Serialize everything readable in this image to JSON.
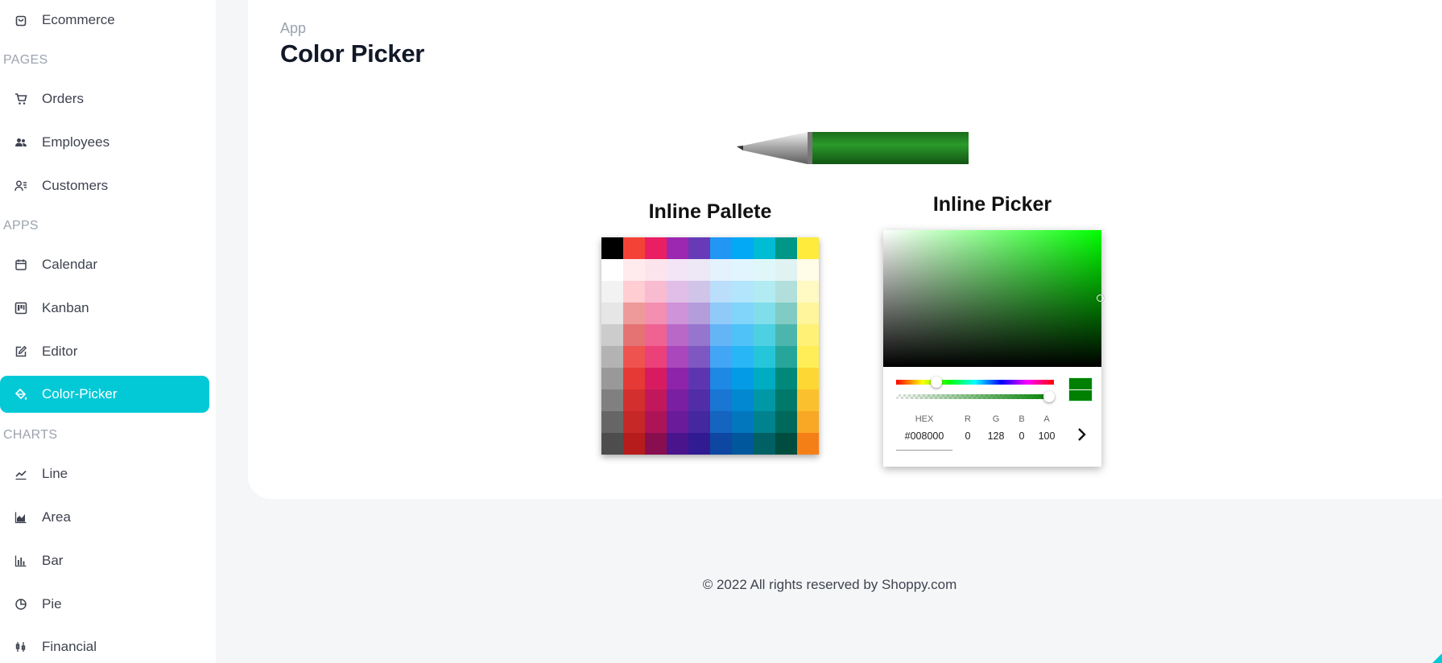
{
  "sidebar": {
    "items": [
      {
        "label": "Ecommerce",
        "icon": "shopping-bag-icon"
      },
      {
        "label": "Orders",
        "icon": "cart-icon"
      },
      {
        "label": "Employees",
        "icon": "employees-icon"
      },
      {
        "label": "Customers",
        "icon": "customers-icon"
      },
      {
        "label": "Calendar",
        "icon": "calendar-icon"
      },
      {
        "label": "Kanban",
        "icon": "kanban-icon"
      },
      {
        "label": "Editor",
        "icon": "edit-icon"
      },
      {
        "label": "Color-Picker",
        "icon": "color-fill-icon"
      },
      {
        "label": "Line",
        "icon": "line-chart-icon"
      },
      {
        "label": "Area",
        "icon": "area-chart-icon"
      },
      {
        "label": "Bar",
        "icon": "bar-chart-icon"
      },
      {
        "label": "Pie",
        "icon": "pie-chart-icon"
      },
      {
        "label": "Financial",
        "icon": "financial-icon"
      }
    ],
    "sections": [
      "PAGES",
      "APPS",
      "CHARTS"
    ],
    "active": "Color-Picker"
  },
  "header": {
    "breadcrumb": "App",
    "title": "Color Picker"
  },
  "pen_color": "#1c7d1c",
  "palette": {
    "title": "Inline Pallete",
    "colors": [
      [
        "#000000",
        "#f44336",
        "#e91e63",
        "#9c27b0",
        "#673ab7",
        "#2196f3",
        "#03a9f4",
        "#00bcd4",
        "#009688",
        "#ffeb3b"
      ],
      [
        "#ffffff",
        "#ffebee",
        "#fce4ec",
        "#f3e5f5",
        "#ede7f6",
        "#e3f2fd",
        "#e1f5fe",
        "#e0f7fa",
        "#e0f2f1",
        "#fffde7"
      ],
      [
        "#f2f2f2",
        "#ffcdd2",
        "#f8bbd0",
        "#e1bee7",
        "#d1c4e9",
        "#bbdefb",
        "#b3e5fc",
        "#b2ebf2",
        "#b2dfdb",
        "#fff9c4"
      ],
      [
        "#e6e6e6",
        "#ef9a9a",
        "#f48fb1",
        "#ce93d8",
        "#b39ddb",
        "#90caf9",
        "#81d4fa",
        "#80deea",
        "#80cbc4",
        "#fff59d"
      ],
      [
        "#cccccc",
        "#e57373",
        "#f06292",
        "#ba68c8",
        "#9575cd",
        "#64b5f6",
        "#4fc3f7",
        "#4dd0e1",
        "#4db6ac",
        "#fff176"
      ],
      [
        "#b3b3b3",
        "#ef5350",
        "#ec407a",
        "#ab47bc",
        "#7e57c2",
        "#42a5f5",
        "#29b6f6",
        "#26c6da",
        "#26a69a",
        "#ffee58"
      ],
      [
        "#999999",
        "#e53935",
        "#d81b60",
        "#8e24aa",
        "#5e35b1",
        "#1e88e5",
        "#039be5",
        "#00acc1",
        "#00897b",
        "#fdd835"
      ],
      [
        "#808080",
        "#d32f2f",
        "#c2185b",
        "#7b1fa2",
        "#512da8",
        "#1976d2",
        "#0288d1",
        "#0097a7",
        "#00796b",
        "#fbc02d"
      ],
      [
        "#666666",
        "#c62828",
        "#ad1457",
        "#6a1b9a",
        "#4527a0",
        "#1565c0",
        "#0277bd",
        "#00838f",
        "#00695c",
        "#f9a825"
      ],
      [
        "#4d4d4d",
        "#b71c1c",
        "#880e4f",
        "#4a148c",
        "#311b92",
        "#0d47a1",
        "#01579b",
        "#006064",
        "#004d40",
        "#f57f17"
      ]
    ]
  },
  "picker": {
    "title": "Inline Picker",
    "hex_label": "HEX",
    "hex_value": "#008000",
    "r_label": "R",
    "r_value": "0",
    "g_label": "G",
    "g_value": "128",
    "b_label": "B",
    "b_value": "0",
    "a_label": "A",
    "a_value": "100",
    "selected_color": "#008000"
  },
  "footer": {
    "text": "© 2022 All rights reserved by Shoppy.com"
  }
}
